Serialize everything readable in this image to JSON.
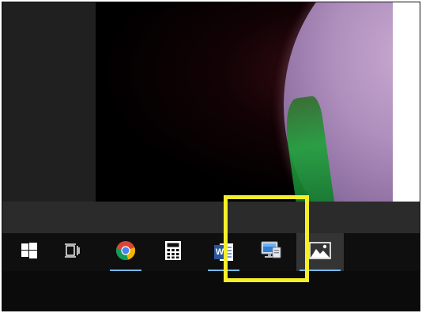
{
  "desktop": {
    "photo_viewer": {
      "content": "image"
    }
  },
  "taskbar": {
    "items": [
      {
        "name": "start-button",
        "icon": "windows-icon",
        "running": false,
        "active": false
      },
      {
        "name": "task-view-button",
        "icon": "task-view-icon",
        "running": false,
        "active": false
      },
      {
        "name": "taskbar-chrome",
        "icon": "chrome-icon",
        "running": true,
        "active": false
      },
      {
        "name": "taskbar-calculator",
        "icon": "calculator-icon",
        "running": false,
        "active": false
      },
      {
        "name": "taskbar-word",
        "icon": "word-icon",
        "label": "W",
        "running": true,
        "active": false
      },
      {
        "name": "taskbar-remote-desktop",
        "icon": "monitor-icon",
        "running": false,
        "active": false
      },
      {
        "name": "taskbar-photos",
        "icon": "photos-icon",
        "running": true,
        "active": true
      }
    ]
  },
  "highlight": {
    "color": "#f4ef2a",
    "target": "taskbar-remote-desktop"
  },
  "colors": {
    "taskbar_bg": "#0f0f0f",
    "running_indicator": "#76b9ed",
    "active_item_bg": "#343434"
  }
}
